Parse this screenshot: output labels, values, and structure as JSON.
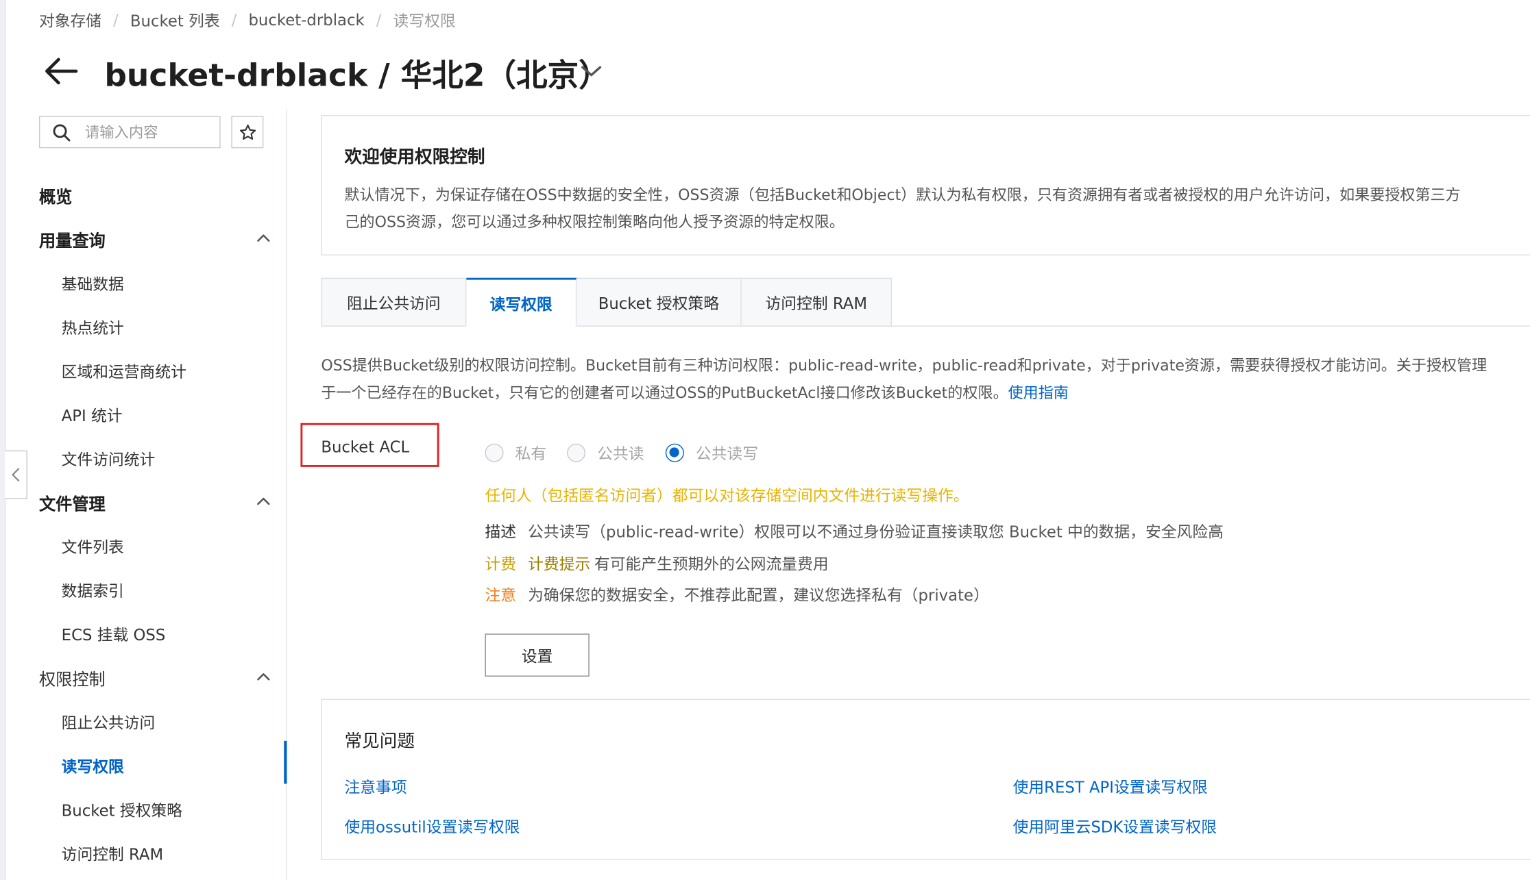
{
  "breadcrumb": [
    "对象存储",
    "Bucket 列表",
    "bucket-drblack",
    "读写权限"
  ],
  "page_title": "bucket-drblack / 华北2（北京）",
  "sidebar": {
    "search_placeholder": "请输入内容",
    "overview": "概览",
    "groups": [
      {
        "label": "用量查询",
        "items": [
          "基础数据",
          "热点统计",
          "区域和运营商统计",
          "API 统计",
          "文件访问统计"
        ]
      },
      {
        "label": "文件管理",
        "items": [
          "文件列表",
          "数据索引",
          "ECS 挂载 OSS"
        ]
      },
      {
        "label": "权限控制",
        "items": [
          "阻止公共访问",
          "读写权限",
          "Bucket 授权策略",
          "访问控制 RAM"
        ]
      }
    ],
    "active_item": "读写权限"
  },
  "welcome": {
    "title": "欢迎使用权限控制",
    "line1": "默认情况下，为保证存储在OSS中数据的安全性，OSS资源（包括Bucket和Object）默认为私有权限，只有资源拥有者或者被授权的用户允许访问，如果要授权第三方",
    "line2": "己的OSS资源，您可以通过多种权限控制策略向他人授予资源的特定权限。"
  },
  "tabs": [
    "阻止公共访问",
    "读写权限",
    "Bucket 授权策略",
    "访问控制 RAM"
  ],
  "active_tab": "读写权限",
  "intro": {
    "line1": "OSS提供Bucket级别的权限访问控制。Bucket目前有三种访问权限：public-read-write，public-read和private，对于private资源，需要获得授权才能访问。关于授权管理",
    "line2": "于一个已经存在的Bucket，只有它的创建者可以通过OSS的PutBucketAcl接口修改该Bucket的权限。",
    "link": "使用指南"
  },
  "acl": {
    "label": "Bucket ACL",
    "options": [
      "私有",
      "公共读",
      "公共读写"
    ],
    "selected": "公共读写",
    "warning": "任何人（包括匿名访问者）都可以对该存储空间内文件进行读写操作。",
    "desc_key": "描述",
    "desc_text": "公共读写（public-read-write）权限可以不通过身份验证直接读取您 Bucket 中的数据，安全风险高",
    "fee_key": "计费",
    "fee_hint": "计费提示",
    "fee_text": "有可能产生预期外的公网流量费用",
    "note_key": "注意",
    "note_text": "为确保您的数据安全，不推荐此配置，建议您选择私有（private）",
    "set_button": "设置"
  },
  "faq": {
    "title": "常见问题",
    "links": [
      "注意事项",
      "使用REST API设置读写权限",
      "使用ossutil设置读写权限",
      "使用阿里云SDK设置读写权限"
    ]
  },
  "colors": {
    "accent": "#0064c8",
    "warning": "#e8b400",
    "note": "#ef7f1a",
    "highlight_box": "#e02020"
  }
}
